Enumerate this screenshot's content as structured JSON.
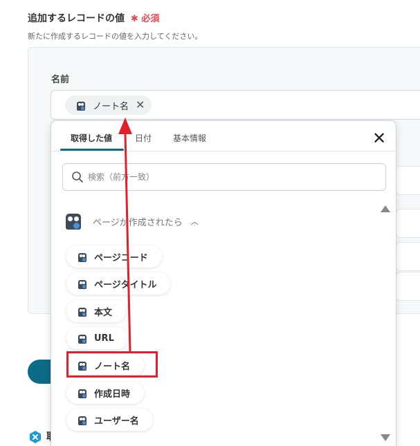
{
  "section": {
    "title": "追加するレコードの値",
    "required_star": "✱",
    "required_label": "必須",
    "description": "新たに作成するレコードの値を入力してください。"
  },
  "field": {
    "label": "名前",
    "chip_label": "ノート名",
    "chip_remove": "✕"
  },
  "picker": {
    "tabs": [
      {
        "label": "取得した値",
        "active": true
      },
      {
        "label": "日付",
        "active": false
      },
      {
        "label": "基本情報",
        "active": false
      }
    ],
    "close_symbol": "✕",
    "search_placeholder": "検索（前方一致）",
    "group": {
      "label": "ページが作成されたら",
      "chevron": "︿"
    },
    "items": [
      {
        "label": "ページコード"
      },
      {
        "label": "ページタイトル"
      },
      {
        "label": "本文"
      },
      {
        "label": "URL"
      },
      {
        "label": "ノート名",
        "highlighted": true
      },
      {
        "label": "作成日時"
      },
      {
        "label": "ユーザー名"
      }
    ]
  },
  "bottom": {
    "text": "取"
  },
  "colors": {
    "accent": "#0e6b88",
    "required": "#e5484d",
    "annotation": "#e0202a"
  },
  "icons": [
    "owl-app-icon",
    "search-icon",
    "close-icon",
    "chevron-up-icon",
    "scroll-up-icon",
    "scroll-down-icon",
    "yoom-logo-icon"
  ]
}
